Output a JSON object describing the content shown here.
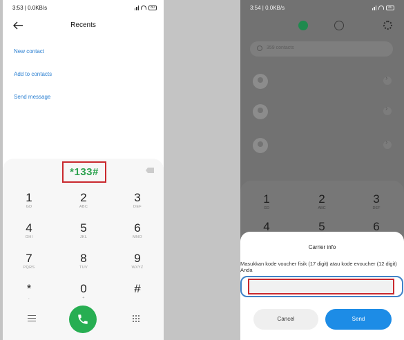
{
  "left": {
    "status": {
      "time": "3:53 | 0.0KB/s",
      "battery": "80"
    },
    "header": {
      "title": "Recents"
    },
    "actions": [
      "New contact",
      "Add to contacts",
      "Send message"
    ],
    "dial_input": "*133#",
    "keys": [
      {
        "num": "1",
        "sub": "GD"
      },
      {
        "num": "2",
        "sub": "ABC"
      },
      {
        "num": "3",
        "sub": "DEF"
      },
      {
        "num": "4",
        "sub": "GHI"
      },
      {
        "num": "5",
        "sub": "JKL"
      },
      {
        "num": "6",
        "sub": "MNO"
      },
      {
        "num": "7",
        "sub": "PQRS"
      },
      {
        "num": "8",
        "sub": "TUV"
      },
      {
        "num": "9",
        "sub": "WXYZ"
      },
      {
        "num": "*",
        "sub": ","
      },
      {
        "num": "0",
        "sub": "+"
      },
      {
        "num": "#",
        "sub": ""
      }
    ],
    "colors": {
      "accent": "#2da24f",
      "link": "#2a7fd1",
      "highlight": "#c9282d"
    }
  },
  "right": {
    "status": {
      "time": "3:54 | 0.0KB/s",
      "battery": "80"
    },
    "search": {
      "placeholder": "359 contacts"
    },
    "keys": [
      {
        "num": "1",
        "sub": "GD"
      },
      {
        "num": "2",
        "sub": "ABC"
      },
      {
        "num": "3",
        "sub": "DEF"
      },
      {
        "num": "4",
        "sub": ""
      },
      {
        "num": "5",
        "sub": ""
      },
      {
        "num": "6",
        "sub": ""
      }
    ],
    "dialog": {
      "title": "Carrier info",
      "message": "Masukkan kode voucher fisik (17 digit)  atau kode evoucher (12 digit) Anda",
      "input_value": "",
      "cancel_label": "Cancel",
      "send_label": "Send"
    },
    "colors": {
      "send": "#1d8ce6",
      "call": "#1f8a4e"
    }
  }
}
